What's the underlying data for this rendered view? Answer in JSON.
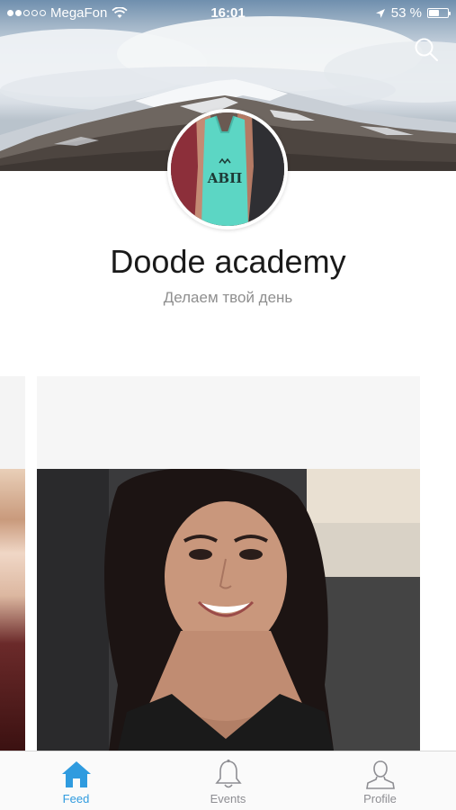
{
  "status_bar": {
    "carrier": "MegaFon",
    "time": "16:01",
    "battery_text": "53 %",
    "battery_level": 0.53,
    "signal_bars_filled": 2,
    "signal_bars_total": 5
  },
  "header": {
    "search_icon": "search-icon",
    "cover_image": "snowy-mountain-cover"
  },
  "profile": {
    "name": "Doode academy",
    "tagline": "Делаем твой день",
    "avatar_image": "avatar-person-mint-tank-top",
    "avatar_shirt_text": "ΑΒΠ"
  },
  "feed": {
    "cards": [
      {
        "image": "partial-previous-photo"
      },
      {
        "image": "selfie-smiling-woman-in-car"
      }
    ]
  },
  "tab_bar": {
    "tabs": [
      {
        "label": "Feed",
        "icon": "house-icon",
        "active": true
      },
      {
        "label": "Events",
        "icon": "bell-icon",
        "active": false
      },
      {
        "label": "Profile",
        "icon": "person-icon",
        "active": false
      }
    ]
  },
  "colors": {
    "accent": "#2f9bdf",
    "inactive": "#8e8e93",
    "title": "#1a1a1a",
    "subtitle": "#8f8f8f"
  }
}
